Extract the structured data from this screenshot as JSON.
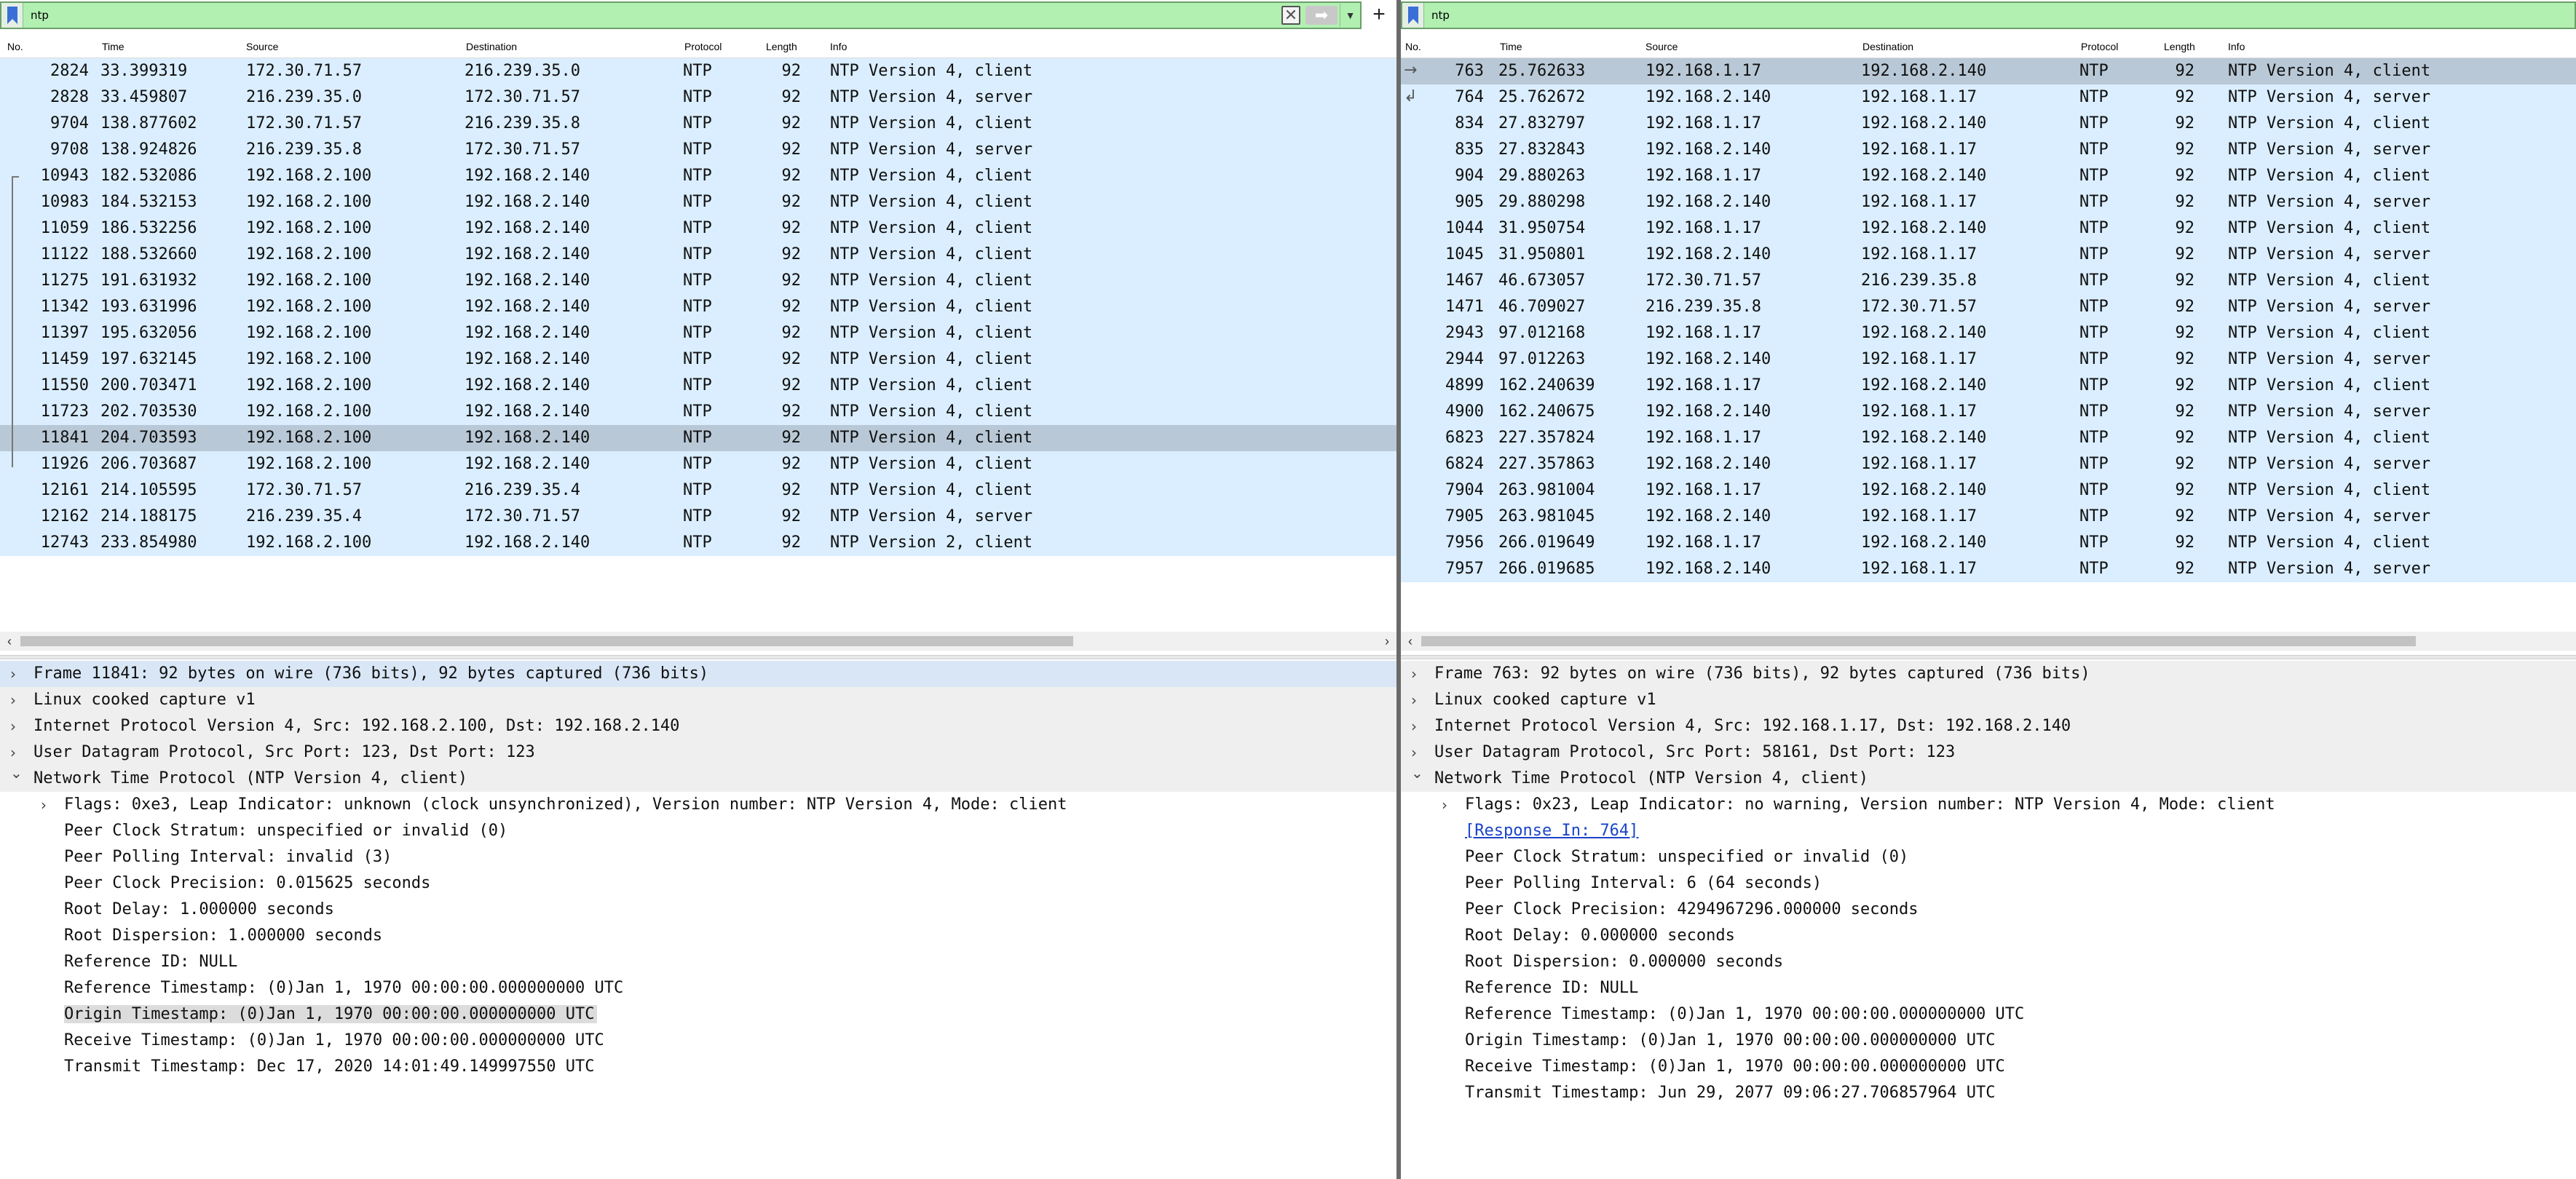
{
  "left": {
    "filter": "ntp",
    "columns": [
      "No.",
      "Time",
      "Source",
      "Destination",
      "Protocol",
      "Length",
      "Info"
    ],
    "packets": [
      {
        "no": "2824",
        "time": "33.399319",
        "src": "172.30.71.57",
        "dst": "216.239.35.0",
        "proto": "NTP",
        "len": "92",
        "info": "NTP Version 4, client"
      },
      {
        "no": "2828",
        "time": "33.459807",
        "src": "216.239.35.0",
        "dst": "172.30.71.57",
        "proto": "NTP",
        "len": "92",
        "info": "NTP Version 4, server"
      },
      {
        "no": "9704",
        "time": "138.877602",
        "src": "172.30.71.57",
        "dst": "216.239.35.8",
        "proto": "NTP",
        "len": "92",
        "info": "NTP Version 4, client"
      },
      {
        "no": "9708",
        "time": "138.924826",
        "src": "216.239.35.8",
        "dst": "172.30.71.57",
        "proto": "NTP",
        "len": "92",
        "info": "NTP Version 4, server"
      },
      {
        "no": "10943",
        "time": "182.532086",
        "src": "192.168.2.100",
        "dst": "192.168.2.140",
        "proto": "NTP",
        "len": "92",
        "info": "NTP Version 4, client"
      },
      {
        "no": "10983",
        "time": "184.532153",
        "src": "192.168.2.100",
        "dst": "192.168.2.140",
        "proto": "NTP",
        "len": "92",
        "info": "NTP Version 4, client"
      },
      {
        "no": "11059",
        "time": "186.532256",
        "src": "192.168.2.100",
        "dst": "192.168.2.140",
        "proto": "NTP",
        "len": "92",
        "info": "NTP Version 4, client"
      },
      {
        "no": "11122",
        "time": "188.532660",
        "src": "192.168.2.100",
        "dst": "192.168.2.140",
        "proto": "NTP",
        "len": "92",
        "info": "NTP Version 4, client"
      },
      {
        "no": "11275",
        "time": "191.631932",
        "src": "192.168.2.100",
        "dst": "192.168.2.140",
        "proto": "NTP",
        "len": "92",
        "info": "NTP Version 4, client"
      },
      {
        "no": "11342",
        "time": "193.631996",
        "src": "192.168.2.100",
        "dst": "192.168.2.140",
        "proto": "NTP",
        "len": "92",
        "info": "NTP Version 4, client"
      },
      {
        "no": "11397",
        "time": "195.632056",
        "src": "192.168.2.100",
        "dst": "192.168.2.140",
        "proto": "NTP",
        "len": "92",
        "info": "NTP Version 4, client"
      },
      {
        "no": "11459",
        "time": "197.632145",
        "src": "192.168.2.100",
        "dst": "192.168.2.140",
        "proto": "NTP",
        "len": "92",
        "info": "NTP Version 4, client"
      },
      {
        "no": "11550",
        "time": "200.703471",
        "src": "192.168.2.100",
        "dst": "192.168.2.140",
        "proto": "NTP",
        "len": "92",
        "info": "NTP Version 4, client"
      },
      {
        "no": "11723",
        "time": "202.703530",
        "src": "192.168.2.100",
        "dst": "192.168.2.140",
        "proto": "NTP",
        "len": "92",
        "info": "NTP Version 4, client"
      },
      {
        "no": "11841",
        "time": "204.703593",
        "src": "192.168.2.100",
        "dst": "192.168.2.140",
        "proto": "NTP",
        "len": "92",
        "info": "NTP Version 4, client",
        "selected": true
      },
      {
        "no": "11926",
        "time": "206.703687",
        "src": "192.168.2.100",
        "dst": "192.168.2.140",
        "proto": "NTP",
        "len": "92",
        "info": "NTP Version 4, client"
      },
      {
        "no": "12161",
        "time": "214.105595",
        "src": "172.30.71.57",
        "dst": "216.239.35.4",
        "proto": "NTP",
        "len": "92",
        "info": "NTP Version 4, client"
      },
      {
        "no": "12162",
        "time": "214.188175",
        "src": "216.239.35.4",
        "dst": "172.30.71.57",
        "proto": "NTP",
        "len": "92",
        "info": "NTP Version 4, server"
      },
      {
        "no": "12743",
        "time": "233.854980",
        "src": "192.168.2.100",
        "dst": "192.168.2.140",
        "proto": "NTP",
        "len": "92",
        "info": "NTP Version 2, client"
      }
    ],
    "details": [
      {
        "level": 0,
        "expanded": false,
        "text": "Frame 11841: 92 bytes on wire (736 bits), 92 bytes captured (736 bits)",
        "highlight": true
      },
      {
        "level": 0,
        "expanded": false,
        "text": "Linux cooked capture v1"
      },
      {
        "level": 0,
        "expanded": false,
        "text": "Internet Protocol Version 4, Src: 192.168.2.100, Dst: 192.168.2.140"
      },
      {
        "level": 0,
        "expanded": false,
        "text": "User Datagram Protocol, Src Port: 123, Dst Port: 123"
      },
      {
        "level": 0,
        "expanded": true,
        "text": "Network Time Protocol (NTP Version 4, client)"
      },
      {
        "level": 1,
        "expandable": true,
        "text": "Flags: 0xe3, Leap Indicator: unknown (clock unsynchronized), Version number: NTP Version 4, Mode: client"
      },
      {
        "level": 1,
        "text": "Peer Clock Stratum: unspecified or invalid (0)"
      },
      {
        "level": 1,
        "text": "Peer Polling Interval: invalid (3)"
      },
      {
        "level": 1,
        "text": "Peer Clock Precision: 0.015625 seconds"
      },
      {
        "level": 1,
        "text": "Root Delay: 1.000000 seconds"
      },
      {
        "level": 1,
        "text": "Root Dispersion: 1.000000 seconds"
      },
      {
        "level": 1,
        "text": "Reference ID: NULL"
      },
      {
        "level": 1,
        "text": "Reference Timestamp: (0)Jan  1, 1970 00:00:00.000000000 UTC"
      },
      {
        "level": 1,
        "text": "Origin Timestamp: (0)Jan  1, 1970 00:00:00.000000000 UTC",
        "highlight": true
      },
      {
        "level": 1,
        "text": "Receive Timestamp: (0)Jan  1, 1970 00:00:00.000000000 UTC"
      },
      {
        "level": 1,
        "text": "Transmit Timestamp: Dec 17, 2020 14:01:49.149997550 UTC"
      }
    ]
  },
  "right": {
    "filter": "ntp",
    "columns": [
      "No.",
      "Time",
      "Source",
      "Destination",
      "Protocol",
      "Length",
      "Info"
    ],
    "packets": [
      {
        "no": "763",
        "time": "25.762633",
        "src": "192.168.1.17",
        "dst": "192.168.2.140",
        "proto": "NTP",
        "len": "92",
        "info": "NTP Version 4, client",
        "selected": true
      },
      {
        "no": "764",
        "time": "25.762672",
        "src": "192.168.2.140",
        "dst": "192.168.1.17",
        "proto": "NTP",
        "len": "92",
        "info": "NTP Version 4, server"
      },
      {
        "no": "834",
        "time": "27.832797",
        "src": "192.168.1.17",
        "dst": "192.168.2.140",
        "proto": "NTP",
        "len": "92",
        "info": "NTP Version 4, client"
      },
      {
        "no": "835",
        "time": "27.832843",
        "src": "192.168.2.140",
        "dst": "192.168.1.17",
        "proto": "NTP",
        "len": "92",
        "info": "NTP Version 4, server"
      },
      {
        "no": "904",
        "time": "29.880263",
        "src": "192.168.1.17",
        "dst": "192.168.2.140",
        "proto": "NTP",
        "len": "92",
        "info": "NTP Version 4, client"
      },
      {
        "no": "905",
        "time": "29.880298",
        "src": "192.168.2.140",
        "dst": "192.168.1.17",
        "proto": "NTP",
        "len": "92",
        "info": "NTP Version 4, server"
      },
      {
        "no": "1044",
        "time": "31.950754",
        "src": "192.168.1.17",
        "dst": "192.168.2.140",
        "proto": "NTP",
        "len": "92",
        "info": "NTP Version 4, client"
      },
      {
        "no": "1045",
        "time": "31.950801",
        "src": "192.168.2.140",
        "dst": "192.168.1.17",
        "proto": "NTP",
        "len": "92",
        "info": "NTP Version 4, server"
      },
      {
        "no": "1467",
        "time": "46.673057",
        "src": "172.30.71.57",
        "dst": "216.239.35.8",
        "proto": "NTP",
        "len": "92",
        "info": "NTP Version 4, client"
      },
      {
        "no": "1471",
        "time": "46.709027",
        "src": "216.239.35.8",
        "dst": "172.30.71.57",
        "proto": "NTP",
        "len": "92",
        "info": "NTP Version 4, server"
      },
      {
        "no": "2943",
        "time": "97.012168",
        "src": "192.168.1.17",
        "dst": "192.168.2.140",
        "proto": "NTP",
        "len": "92",
        "info": "NTP Version 4, client"
      },
      {
        "no": "2944",
        "time": "97.012263",
        "src": "192.168.2.140",
        "dst": "192.168.1.17",
        "proto": "NTP",
        "len": "92",
        "info": "NTP Version 4, server"
      },
      {
        "no": "4899",
        "time": "162.240639",
        "src": "192.168.1.17",
        "dst": "192.168.2.140",
        "proto": "NTP",
        "len": "92",
        "info": "NTP Version 4, client"
      },
      {
        "no": "4900",
        "time": "162.240675",
        "src": "192.168.2.140",
        "dst": "192.168.1.17",
        "proto": "NTP",
        "len": "92",
        "info": "NTP Version 4, server"
      },
      {
        "no": "6823",
        "time": "227.357824",
        "src": "192.168.1.17",
        "dst": "192.168.2.140",
        "proto": "NTP",
        "len": "92",
        "info": "NTP Version 4, client"
      },
      {
        "no": "6824",
        "time": "227.357863",
        "src": "192.168.2.140",
        "dst": "192.168.1.17",
        "proto": "NTP",
        "len": "92",
        "info": "NTP Version 4, server"
      },
      {
        "no": "7904",
        "time": "263.981004",
        "src": "192.168.1.17",
        "dst": "192.168.2.140",
        "proto": "NTP",
        "len": "92",
        "info": "NTP Version 4, client"
      },
      {
        "no": "7905",
        "time": "263.981045",
        "src": "192.168.2.140",
        "dst": "192.168.1.17",
        "proto": "NTP",
        "len": "92",
        "info": "NTP Version 4, server"
      },
      {
        "no": "7956",
        "time": "266.019649",
        "src": "192.168.1.17",
        "dst": "192.168.2.140",
        "proto": "NTP",
        "len": "92",
        "info": "NTP Version 4, client"
      },
      {
        "no": "7957",
        "time": "266.019685",
        "src": "192.168.2.140",
        "dst": "192.168.1.17",
        "proto": "NTP",
        "len": "92",
        "info": "NTP Version 4, server"
      }
    ],
    "details": [
      {
        "level": 0,
        "expanded": false,
        "text": "Frame 763: 92 bytes on wire (736 bits), 92 bytes captured (736 bits)"
      },
      {
        "level": 0,
        "expanded": false,
        "text": "Linux cooked capture v1"
      },
      {
        "level": 0,
        "expanded": false,
        "text": "Internet Protocol Version 4, Src: 192.168.1.17, Dst: 192.168.2.140"
      },
      {
        "level": 0,
        "expanded": false,
        "text": "User Datagram Protocol, Src Port: 58161, Dst Port: 123"
      },
      {
        "level": 0,
        "expanded": true,
        "text": "Network Time Protocol (NTP Version 4, client)"
      },
      {
        "level": 1,
        "expandable": true,
        "text": "Flags: 0x23, Leap Indicator: no warning, Version number: NTP Version 4, Mode: client"
      },
      {
        "level": 1,
        "link": true,
        "text": "[Response In: 764]"
      },
      {
        "level": 1,
        "text": "Peer Clock Stratum: unspecified or invalid (0)"
      },
      {
        "level": 1,
        "text": "Peer Polling Interval: 6 (64 seconds)"
      },
      {
        "level": 1,
        "text": "Peer Clock Precision: 4294967296.000000 seconds"
      },
      {
        "level": 1,
        "text": "Root Delay: 0.000000 seconds"
      },
      {
        "level": 1,
        "text": "Root Dispersion: 0.000000 seconds"
      },
      {
        "level": 1,
        "text": "Reference ID: NULL"
      },
      {
        "level": 1,
        "text": "Reference Timestamp: (0)Jan  1, 1970 00:00:00.000000000 UTC"
      },
      {
        "level": 1,
        "text": "Origin Timestamp: (0)Jan  1, 1970 00:00:00.000000000 UTC"
      },
      {
        "level": 1,
        "text": "Receive Timestamp: (0)Jan  1, 1970 00:00:00.000000000 UTC"
      },
      {
        "level": 1,
        "text": "Transmit Timestamp: Jun 29, 2077 09:06:27.706857964 UTC"
      }
    ]
  },
  "icons": {
    "bookmark": "bookmark-icon",
    "clear": "clear-filter-icon",
    "apply": "apply-arrow-icon",
    "dropdown": "chevron-down-icon",
    "add": "plus-icon",
    "expand": "chevron-right-icon",
    "collapse": "chevron-down-icon"
  },
  "colors": {
    "filter_valid": "#b2f0b2",
    "row_bg": "#daeeff",
    "row_selected": "#b8c8d6",
    "link": "#1a44c8"
  }
}
